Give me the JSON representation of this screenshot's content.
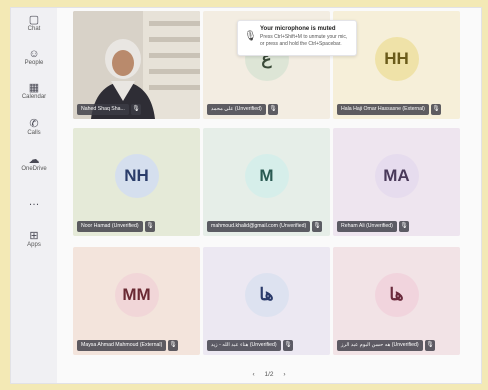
{
  "rail": [
    {
      "icon": "chat-icon",
      "glyph": "▢",
      "label": "Chat"
    },
    {
      "icon": "people-icon",
      "glyph": "☺",
      "label": "People"
    },
    {
      "icon": "calendar-icon",
      "glyph": "▦",
      "label": "Calendar"
    },
    {
      "icon": "call-icon",
      "glyph": "✆",
      "label": "Calls"
    },
    {
      "icon": "onedrive-icon",
      "glyph": "☁",
      "label": "OneDrive"
    },
    {
      "icon": "more-icon",
      "glyph": "…",
      "label": ""
    },
    {
      "icon": "apps-icon",
      "glyph": "⊞",
      "label": "Apps"
    }
  ],
  "toast": {
    "title": "Your microphone is muted",
    "body": "Press Ctrl+Shift+M to unmute your mic, or press and hold the Ctrl+Spacebar."
  },
  "tiles": [
    {
      "name": "Nahed Shaq Sha...",
      "initials": "",
      "video": true,
      "bg": "#cfc9c0"
    },
    {
      "name": "علي محمد (Unverified)",
      "initials": "ع",
      "bg": "#f3ede2",
      "avatar_bg": "#dde5d6",
      "avatar_fg": "#3a4a38"
    },
    {
      "name": "Hala Haji Omar Hassasne (External)",
      "initials": "HH",
      "bg": "#f6efd9",
      "avatar_bg": "#efe2a8",
      "avatar_fg": "#6a5b1a"
    },
    {
      "name": "Noor Hamad (Unverified)",
      "initials": "NH",
      "bg": "#e5ead8",
      "avatar_bg": "#d5dfee",
      "avatar_fg": "#2a3c6a"
    },
    {
      "name": "mahmoud.khalid@gmail.com (Unverified)",
      "initials": "M",
      "bg": "#e6eee8",
      "avatar_bg": "#d6eeea",
      "avatar_fg": "#2a5a52"
    },
    {
      "name": "Reham Ali (Unverified)",
      "initials": "MA",
      "bg": "#eee5ef",
      "avatar_bg": "#e6dcee",
      "avatar_fg": "#4a3a5a"
    },
    {
      "name": "Maysa Ahmad Mahmoud (External)",
      "initials": "MM",
      "bg": "#f3e4dc",
      "avatar_bg": "#f1d6d8",
      "avatar_fg": "#6a2a34"
    },
    {
      "name": "هناء عبد الله - زيد (Unverified)",
      "initials": "ها",
      "bg": "#ece8f2",
      "avatar_bg": "#dde2f0",
      "avatar_fg": "#2a3a6a"
    },
    {
      "name": "هه حسن البوم عبد الرز (Unverified)",
      "initials": "ها",
      "bg": "#f2e3e6",
      "avatar_bg": "#f1d4dd",
      "avatar_fg": "#6a2a3c"
    }
  ],
  "pager": {
    "prev": "‹",
    "label": "1/2",
    "next": "›"
  },
  "colors": {
    "page_bg": "#f3e9b5",
    "label_bg": "#3c3c46"
  }
}
